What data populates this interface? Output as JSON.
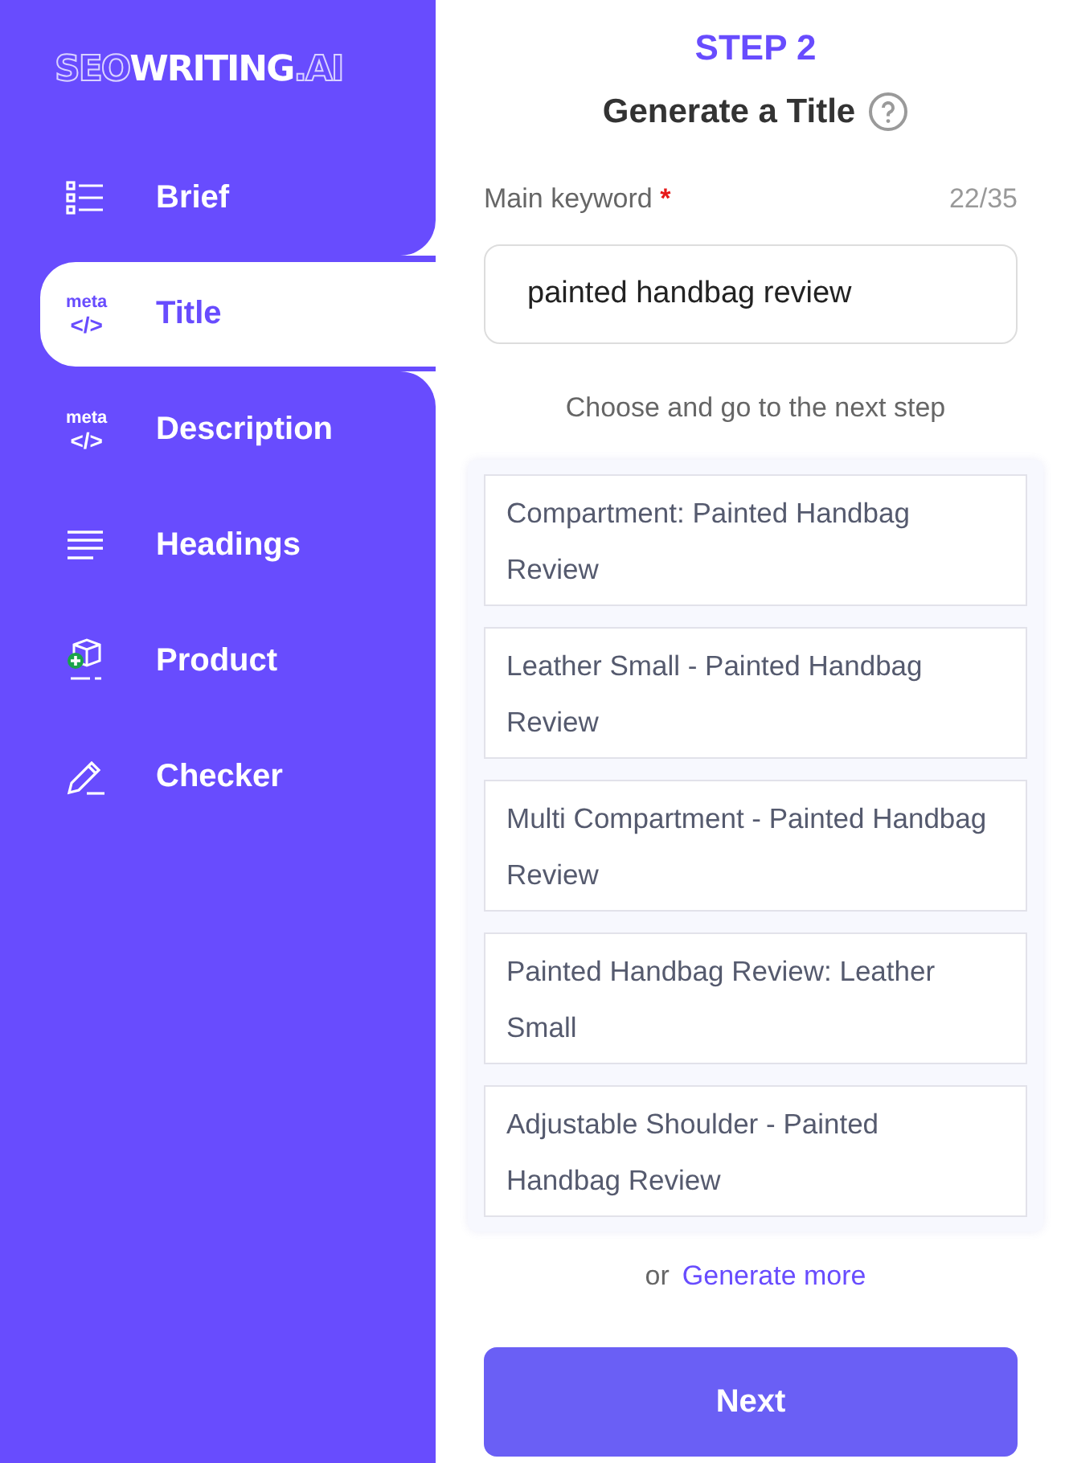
{
  "logo": {
    "outlined": "SEO",
    "solid": "WRITING",
    "suffix": ".AI"
  },
  "sidebar": {
    "items": [
      {
        "kind": "list",
        "label": "Brief",
        "selected": false
      },
      {
        "kind": "meta",
        "label": "Title",
        "icon_top": "meta",
        "icon_code": "</>",
        "selected": true
      },
      {
        "kind": "meta",
        "label": "Description",
        "icon_top": "meta",
        "icon_code": "</>",
        "selected": false
      },
      {
        "kind": "lines",
        "label": "Headings",
        "selected": false
      },
      {
        "kind": "product",
        "label": "Product",
        "selected": false
      },
      {
        "kind": "pencil",
        "label": "Checker",
        "selected": false
      }
    ]
  },
  "step": "STEP 2",
  "heading": "Generate a Title",
  "keyword": {
    "label": "Main keyword",
    "required_mark": "*",
    "counter": "22/35",
    "value": "painted handbag review"
  },
  "instruction": "Choose and go to the next step",
  "options": [
    {
      "text": "Compartment: Painted Handbag Review"
    },
    {
      "text": "Leather Small - Painted Handbag Review"
    },
    {
      "text": "Multi Compartment - Painted Handbag Review"
    },
    {
      "text": "Painted Handbag Review: Leather Small"
    },
    {
      "text": "Adjustable Shoulder - Painted Handbag Review"
    }
  ],
  "more": {
    "prefix": "or",
    "link": "Generate more"
  },
  "next_button": "Next"
}
